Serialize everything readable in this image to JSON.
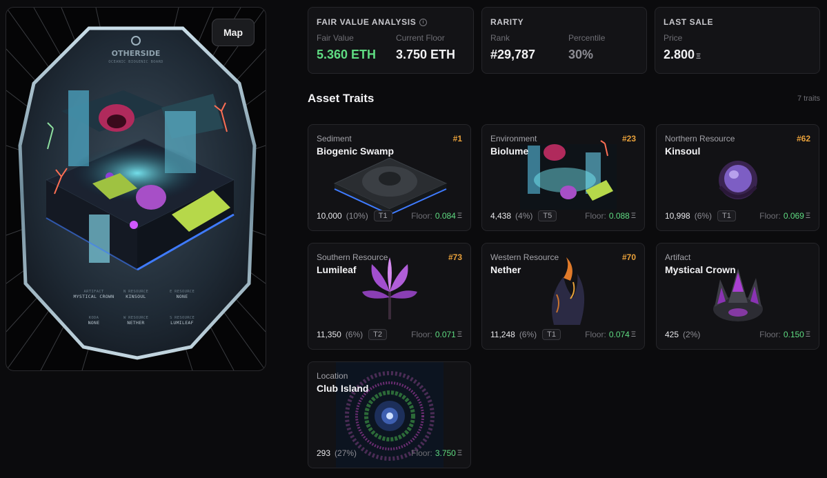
{
  "map_button": {
    "label": "Map"
  },
  "fair_value": {
    "header": "FAIR VALUE ANALYSIS",
    "fair_label": "Fair Value",
    "fair_value": "5.360 ETH",
    "floor_label": "Current Floor",
    "floor_value": "3.750 ETH"
  },
  "rarity": {
    "header": "RARITY",
    "rank_label": "Rank",
    "rank_value": "#29,787",
    "percentile_label": "Percentile",
    "percentile_value": "30%"
  },
  "last_sale": {
    "header": "LAST SALE",
    "price_label": "Price",
    "price_value": "2.800",
    "currency_glyph": "Ξ"
  },
  "traits_section": {
    "title": "Asset Traits",
    "count": "7 traits",
    "floor_label": "Floor:",
    "currency_glyph": "Ξ"
  },
  "traits": [
    {
      "category": "Sediment",
      "name": "Biogenic Swamp",
      "rank": "#1",
      "count": "10,000",
      "pct": "(10%)",
      "tier": "T1",
      "floor": "0.084"
    },
    {
      "category": "Environment",
      "name": "Biolume",
      "rank": "#23",
      "count": "4,438",
      "pct": "(4%)",
      "tier": "T5",
      "floor": "0.088"
    },
    {
      "category": "Northern Resource",
      "name": "Kinsoul",
      "rank": "#62",
      "count": "10,998",
      "pct": "(6%)",
      "tier": "T1",
      "floor": "0.069"
    },
    {
      "category": "Southern Resource",
      "name": "Lumileaf",
      "rank": "#73",
      "count": "11,350",
      "pct": "(6%)",
      "tier": "T2",
      "floor": "0.071"
    },
    {
      "category": "Western Resource",
      "name": "Nether",
      "rank": "#70",
      "count": "11,248",
      "pct": "(6%)",
      "tier": "T1",
      "floor": "0.074"
    },
    {
      "category": "Artifact",
      "name": "Mystical Crown",
      "rank": "",
      "count": "425",
      "pct": "(2%)",
      "tier": "",
      "floor": "0.150"
    },
    {
      "category": "Location",
      "name": "Club Island",
      "rank": "",
      "count": "293",
      "pct": "(27%)",
      "tier": "",
      "floor": "3.750"
    }
  ],
  "card_caption": {
    "title": "OTHERSIDE",
    "subtitle": "OCEANIC BIOGENIC BOARD",
    "row1": [
      {
        "label": "ARTIFACT",
        "value": "MYSTICAL CROWN"
      },
      {
        "label": "N RESOURCE",
        "value": "KINSOUL"
      },
      {
        "label": "E RESOURCE",
        "value": "NONE"
      }
    ],
    "row2": [
      {
        "label": "KODA",
        "value": "NONE"
      },
      {
        "label": "W RESOURCE",
        "value": "NETHER"
      },
      {
        "label": "S RESOURCE",
        "value": "LUMILEAF"
      }
    ]
  },
  "colors": {
    "accent_green": "#5fdc82",
    "rank_orange": "#e9a13b",
    "background": "#0b0b0d",
    "card": "#131316"
  }
}
